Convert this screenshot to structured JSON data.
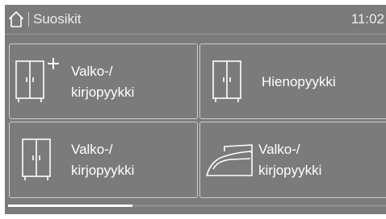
{
  "header": {
    "home_icon": "home-icon",
    "title": "Suosikit",
    "time": "11:02"
  },
  "tiles": [
    {
      "icon": "wardrobe-add-icon",
      "label_line1": "Valko-/",
      "label_line2": "kirjopyykki"
    },
    {
      "icon": "wardrobe-icon",
      "label": "Hienopyykki"
    },
    {
      "icon": "wardrobe-icon",
      "label_line1": "Valko-/",
      "label_line2": "kirjopyykki"
    },
    {
      "icon": "iron-icon",
      "label_line1": "Valko-/",
      "label_line2": "kirjopyykki"
    }
  ],
  "scroll_indicator": {
    "position": 0.33
  },
  "colors": {
    "background": "#7b7b7b",
    "foreground": "#ffffff",
    "border": "#cdcdcd"
  }
}
